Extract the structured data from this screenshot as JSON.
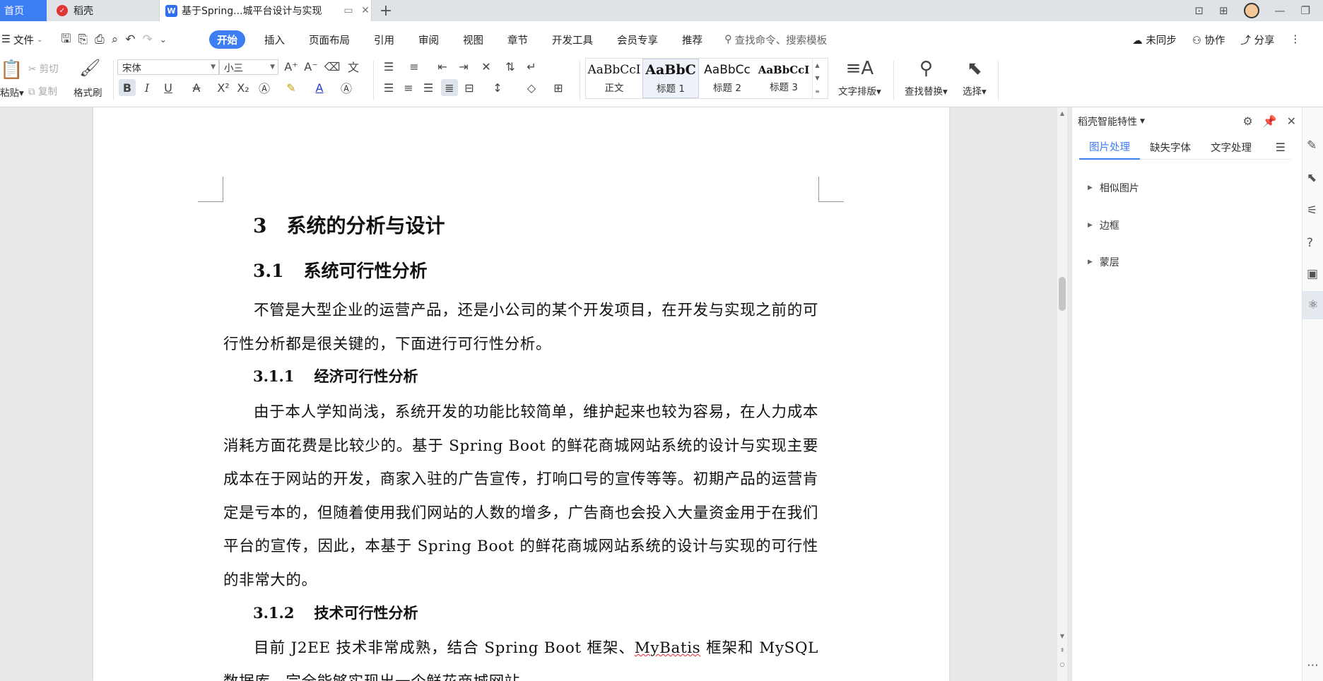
{
  "tabs": {
    "home": "首页",
    "daoke": "稻壳",
    "doc_title": "基于Spring...城平台设计与实现"
  },
  "menubar": {
    "file": "文件",
    "items": [
      "开始",
      "插入",
      "页面布局",
      "引用",
      "审阅",
      "视图",
      "章节",
      "开发工具",
      "会员专享",
      "推荐"
    ],
    "search_placeholder": "查找命令、搜索模板",
    "unsynced": "未同步",
    "collab": "协作",
    "share": "分享"
  },
  "ribbon": {
    "paste": "粘贴",
    "cut": "剪切",
    "copy": "复制",
    "format_painter": "格式刷",
    "font_name": "宋体",
    "font_size": "小三",
    "styles": [
      {
        "preview": "AaBbCcI",
        "caption": "正文"
      },
      {
        "preview": "AaBbC",
        "caption": "标题 1"
      },
      {
        "preview": "AaBbCc",
        "caption": "标题 2"
      },
      {
        "preview": "AaBbCcI",
        "caption": "标题 3"
      }
    ],
    "text_layout": "文字排版",
    "find_replace": "查找替换",
    "select": "选择"
  },
  "document": {
    "h1_num": "3",
    "h1_text": "系统的分析与设计",
    "h2_num": "3.1",
    "h2_text": "系统可行性分析",
    "p1": "不管是大型企业的运营产品，还是小公司的某个开发项目，在开发与实现之前的可行性分析都是很关键的，下面进行可行性分析。",
    "h3a_num": "3.1.1",
    "h3a_text": "经济可行性分析",
    "p2": "由于本人学知尚浅，系统开发的功能比较简单，维护起来也较为容易，在人力成本消耗方面花费是比较少的。基于 Spring Boot 的鲜花商城网站系统的设计与实现主要成本在于网站的开发，商家入驻的广告宣传，打响口号的宣传等等。初期产品的运营肯定是亏本的，但随着使用我们网站的人数的增多，广告商也会投入大量资金用于在我们平台的宣传，因此，本基于 Spring Boot 的鲜花商城网站系统的设计与实现的可行性的非常大的。",
    "h3b_num": "3.1.2",
    "h3b_text": "技术可行性分析",
    "p3_a": "目前 J2EE 技术非常成熟，结合 Spring Boot 框架、",
    "p3_b": "MyBatis",
    "p3_c": " 框架和 MySQL 数据库，完全能够实现出一个鲜花商城网站"
  },
  "panel": {
    "title": "稻壳智能特性",
    "tabs": [
      "图片处理",
      "缺失字体",
      "文字处理"
    ],
    "sections": [
      "相似图片",
      "边框",
      "蒙层"
    ]
  },
  "colors": {
    "accent": "#3d7ef5",
    "tabbar": "#dfe3e8"
  }
}
